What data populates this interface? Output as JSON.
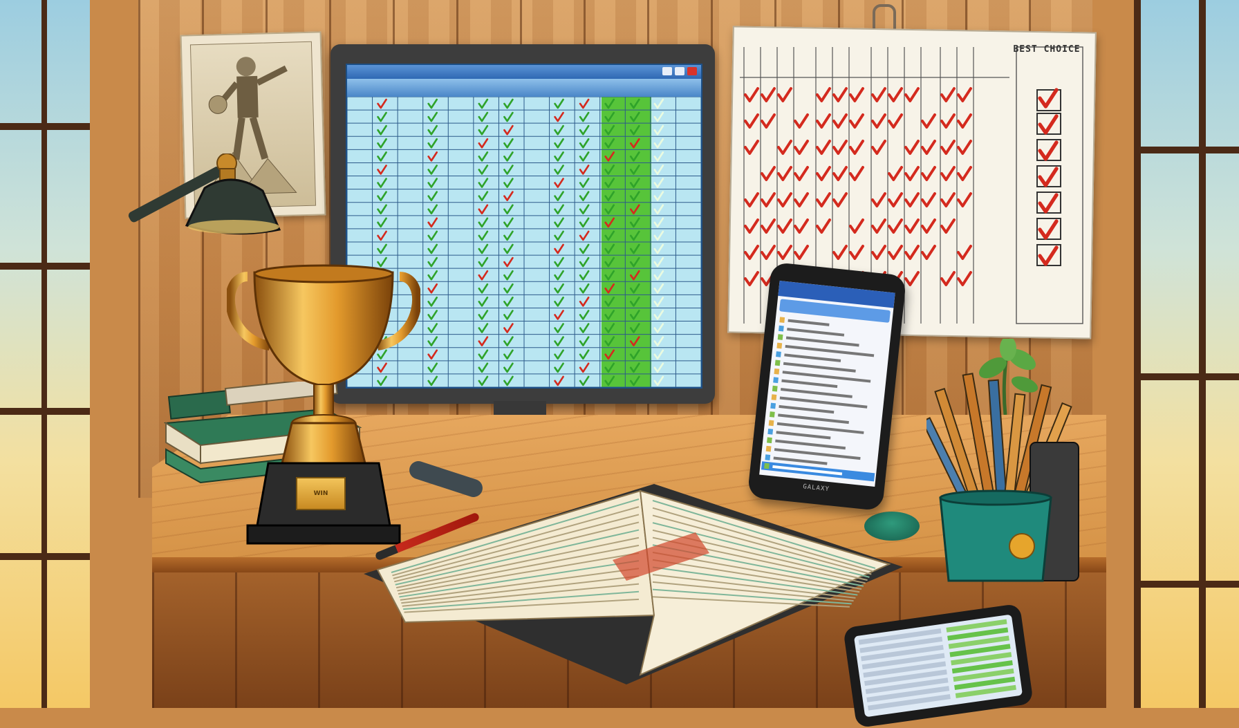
{
  "scene": {
    "subject": "illustrated study desk",
    "colors": {
      "wood_wall": "#c98a4c",
      "curtain": "#0f5a5a",
      "check_green": "#2fa32a",
      "check_red": "#d42a1e",
      "trophy_gold": "#e7a533",
      "screen_blue": "#b9e6f2"
    }
  },
  "wallchart": {
    "title": "BEST CHOICE",
    "check_icon": "red-check-icon"
  },
  "monitor": {
    "check_icon": "green-check-icon"
  },
  "phone": {
    "brand": "GALAXY"
  },
  "trophy": {
    "plate_text": "WIN"
  }
}
